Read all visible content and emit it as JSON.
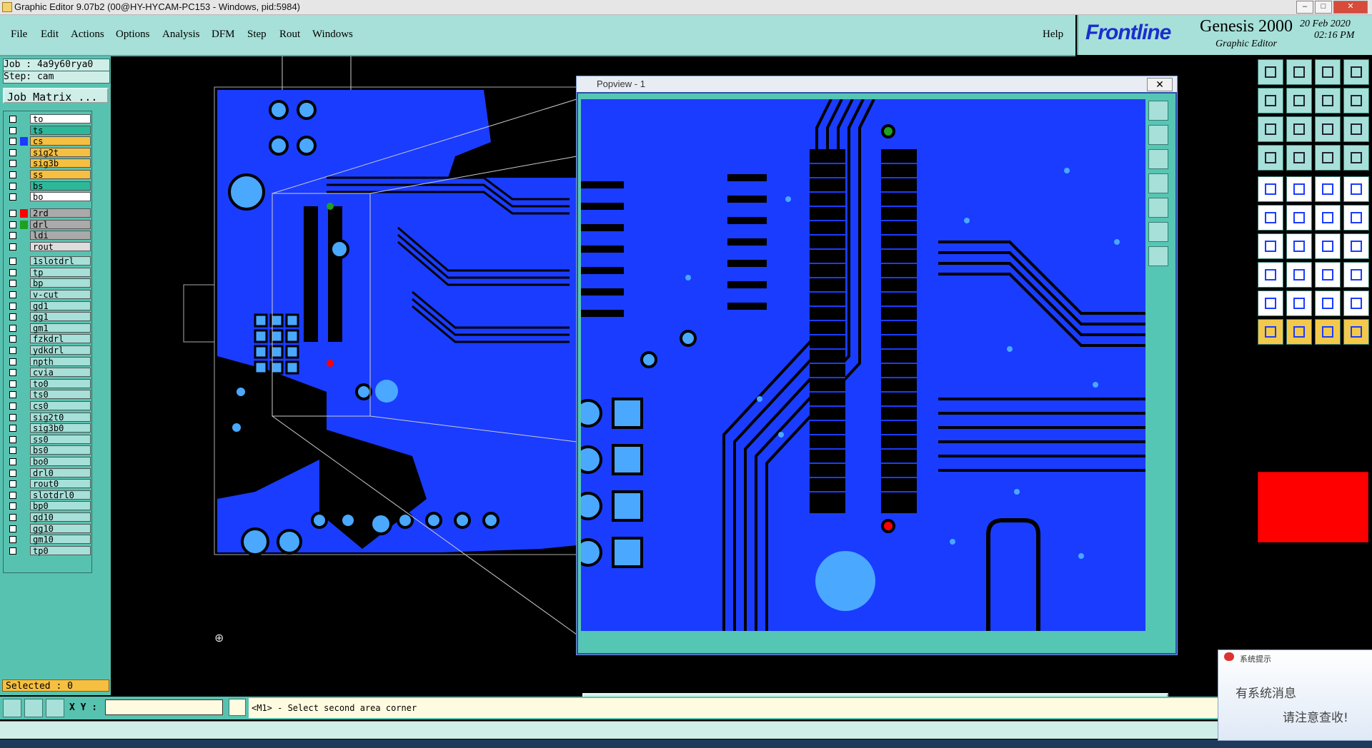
{
  "window": {
    "title": "Graphic Editor 9.07b2 (00@HY-HYCAM-PC153 - Windows, pid:5984)"
  },
  "menu": {
    "items": [
      "File",
      "Edit",
      "Actions",
      "Options",
      "Analysis",
      "DFM",
      "Step",
      "Rout",
      "Windows"
    ],
    "help": "Help"
  },
  "brand": {
    "logo": "Frontline",
    "product": "Genesis 2000",
    "subtitle": "Graphic Editor",
    "date": "20 Feb 2020",
    "time": "02:16 PM"
  },
  "job": {
    "job_line": "Job : 4a9y60rya0",
    "step_line": "Step: cam",
    "matrix_button": "Job Matrix ..."
  },
  "layers": [
    {
      "name": "to",
      "color": "#ffffff"
    },
    {
      "name": "ts",
      "color": "#2eb89a"
    },
    {
      "name": "cs",
      "color": "#f5c041",
      "swatch": "#1a3cff"
    },
    {
      "name": "sig2t",
      "color": "#f5c041"
    },
    {
      "name": "sig3b",
      "color": "#f5c041"
    },
    {
      "name": "ss",
      "color": "#f5c041"
    },
    {
      "name": "bs",
      "color": "#2eb89a"
    },
    {
      "name": "bo",
      "color": "#ffffff"
    },
    {
      "name": "2rd",
      "color": "#aaaaaa",
      "swatch": "#ff0000"
    },
    {
      "name": "drl",
      "color": "#aaaaaa",
      "swatch": "#1fa01f"
    },
    {
      "name": "ldi",
      "color": "#aaaaaa"
    },
    {
      "name": "rout",
      "color": "#dddddd"
    },
    {
      "name": "1slotdrl",
      "color": "#a6e0d8"
    },
    {
      "name": "tp",
      "color": "#a6e0d8"
    },
    {
      "name": "bp",
      "color": "#a6e0d8"
    },
    {
      "name": "v-cut",
      "color": "#a6e0d8"
    },
    {
      "name": "gd1",
      "color": "#a6e0d8"
    },
    {
      "name": "gg1",
      "color": "#a6e0d8"
    },
    {
      "name": "gm1",
      "color": "#a6e0d8"
    },
    {
      "name": "fzkdrl",
      "color": "#a6e0d8"
    },
    {
      "name": "ydkdrl",
      "color": "#a6e0d8"
    },
    {
      "name": "npth",
      "color": "#a6e0d8"
    },
    {
      "name": "cvia",
      "color": "#a6e0d8"
    },
    {
      "name": "to0",
      "color": "#a6e0d8"
    },
    {
      "name": "ts0",
      "color": "#a6e0d8"
    },
    {
      "name": "cs0",
      "color": "#a6e0d8"
    },
    {
      "name": "sig2t0",
      "color": "#a6e0d8"
    },
    {
      "name": "sig3b0",
      "color": "#a6e0d8"
    },
    {
      "name": "ss0",
      "color": "#a6e0d8"
    },
    {
      "name": "bs0",
      "color": "#a6e0d8"
    },
    {
      "name": "bo0",
      "color": "#a6e0d8"
    },
    {
      "name": "drl0",
      "color": "#a6e0d8"
    },
    {
      "name": "rout0",
      "color": "#a6e0d8"
    },
    {
      "name": "slotdrl0",
      "color": "#a6e0d8"
    },
    {
      "name": "bp0",
      "color": "#a6e0d8"
    },
    {
      "name": "gd10",
      "color": "#a6e0d8"
    },
    {
      "name": "gg10",
      "color": "#a6e0d8"
    },
    {
      "name": "gm10",
      "color": "#a6e0d8"
    },
    {
      "name": "tp0",
      "color": "#a6e0d8"
    }
  ],
  "selected": "Selected : 0",
  "popview": {
    "title": "Popview - 1",
    "close_label": "Close"
  },
  "status": {
    "coord_label": "X Y :",
    "coord_value": "",
    "prompt": "<M1> - Select second area corner"
  },
  "notification": {
    "title": "系统提示",
    "line1": "有系统消息",
    "line2": "请注意查收!"
  },
  "colors": {
    "copper": "#1a3cff",
    "pad": "#4aa8ff",
    "accent": "#a6e0d8",
    "panel": "#58c2b0"
  }
}
